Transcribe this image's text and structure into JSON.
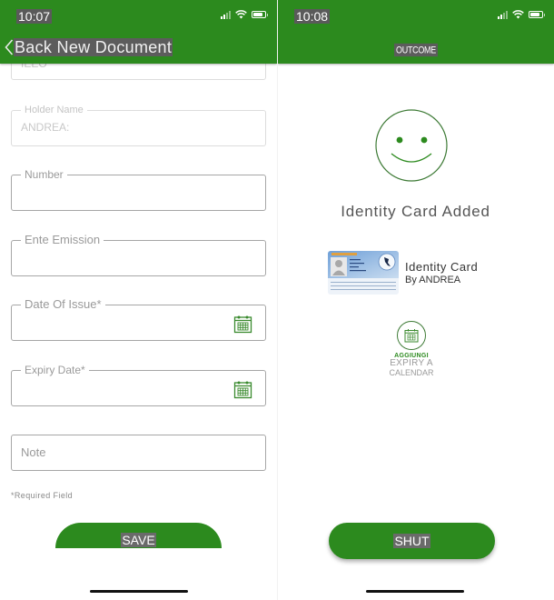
{
  "left": {
    "status_time": "10:07",
    "header": {
      "back_label": "Back New Document"
    },
    "fields": [
      {
        "label": "",
        "value": "IEEO",
        "state": "disabled"
      },
      {
        "label": "Holder Name",
        "value": "ANDREA:",
        "state": "disabled"
      },
      {
        "label": "Number",
        "value": ""
      },
      {
        "label": "Ente Emission",
        "value": ""
      },
      {
        "label": "Date Of Issue*",
        "value": "",
        "icon": "calendar-icon"
      },
      {
        "label": "Expiry Date*",
        "value": "",
        "icon": "calendar-icon"
      },
      {
        "placeholder": "Note",
        "value": ""
      }
    ],
    "required_note": "*Required Field",
    "save_label": "SAVE"
  },
  "right": {
    "status_time": "10:08",
    "header": {
      "title": "OUTCOME"
    },
    "result_icon": "smiley-icon",
    "result_title": "Identity Card Added",
    "document": {
      "title": "Identity Card",
      "subtitle": "By ANDREA",
      "thumbnail": "identity-card-image"
    },
    "calendar_action": {
      "line1": "AGGIUNGI",
      "line2": "EXPIRY A",
      "line3": "CALENDAR"
    },
    "shut_label": "SHUT"
  },
  "colors": {
    "brand_green": "#2c8a1e",
    "field_border": "#a6a6a6",
    "text_gray": "#9a9a9a"
  }
}
